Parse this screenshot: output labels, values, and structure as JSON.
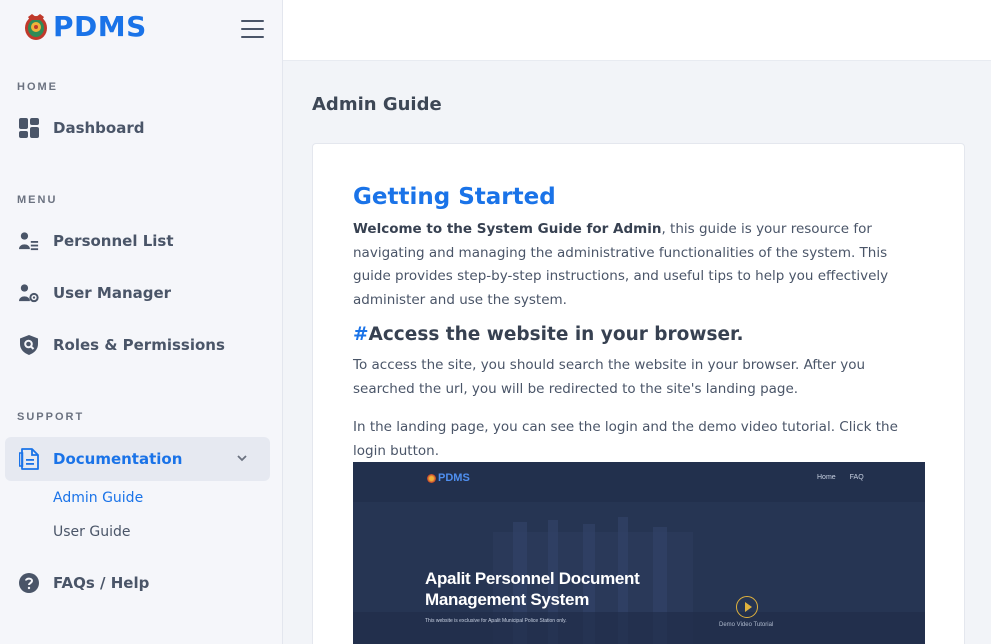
{
  "brand": {
    "name": "PDMS"
  },
  "sidebar": {
    "sections": {
      "home": "HOME",
      "menu": "MENU",
      "support": "SUPPORT"
    },
    "items": [
      {
        "label": "Dashboard",
        "icon": "dashboard-icon"
      },
      {
        "label": "Personnel List",
        "icon": "personnel-list-icon"
      },
      {
        "label": "User Manager",
        "icon": "user-manager-icon"
      },
      {
        "label": "Roles & Permissions",
        "icon": "shield-icon"
      },
      {
        "label": "Documentation",
        "icon": "document-icon",
        "active": true
      },
      {
        "label": "FAQs / Help",
        "icon": "help-icon"
      }
    ],
    "sub_items": [
      {
        "label": "Admin Guide",
        "active": true
      },
      {
        "label": "User Guide"
      }
    ]
  },
  "page": {
    "title": "Admin Guide"
  },
  "content": {
    "heading": "Getting Started",
    "intro_bold": "Welcome to the System Guide for Admin",
    "intro_rest": ", this guide is your resource for navigating and managing the administrative functionalities of the system. This guide provides step-by-step instructions, and useful tips to help you effectively administer and use the system.",
    "section_hash": "#",
    "section_heading": "Access the website in your browser.",
    "para1": "To access the site, you should search the website in your browser. After you searched the url, you will be redirected to the site's landing page.",
    "para2": "In the landing page, you can see the login and the demo video tutorial. Click the login button."
  },
  "screenshot": {
    "brand": "PDMS",
    "nav": [
      "Home",
      "FAQ"
    ],
    "title_line1": "Apalit Personnel Document",
    "title_line2": "Management System",
    "subtitle": "This website is exclusive for Apalit Municipal Police Station only.",
    "video_label": "Demo Video Tutorial"
  },
  "colors": {
    "accent": "#1a73e8",
    "sidebar_bg": "#f5f6fa",
    "active_bg": "#e6e9f1",
    "page_bg": "#f2f4f8",
    "screenshot_bg": "#22304d"
  }
}
